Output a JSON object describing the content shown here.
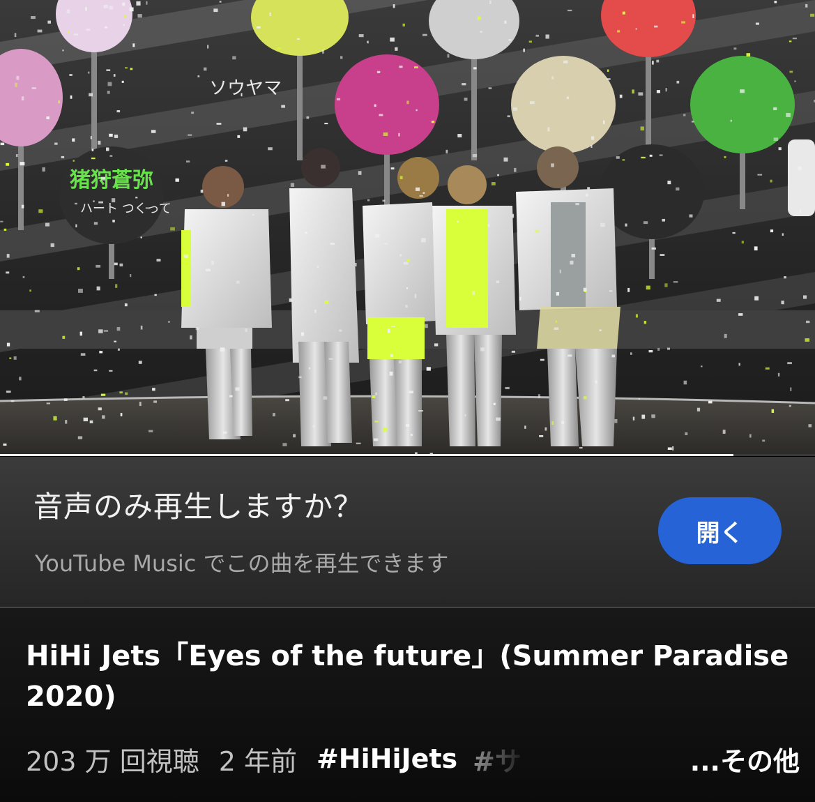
{
  "video": {
    "progress_fraction": 0.9,
    "stage_signs": [
      "ソウヤマ",
      "猪狩蒼弥",
      "ハート つくって"
    ]
  },
  "prompt": {
    "title": "音声のみ再生しますか？",
    "subtitle": "YouTube Music でこの曲を再生できます",
    "open_label": "開く",
    "button_color": "#2563d6"
  },
  "details": {
    "title": "HiHi Jets「Eyes of the future」(Summer Paradise 2020)",
    "views": "203 万 回視聴",
    "age": "2 年前",
    "hashtag": "#HiHiJets",
    "hashtag_cut": "#サ",
    "more_label": "...その他"
  }
}
